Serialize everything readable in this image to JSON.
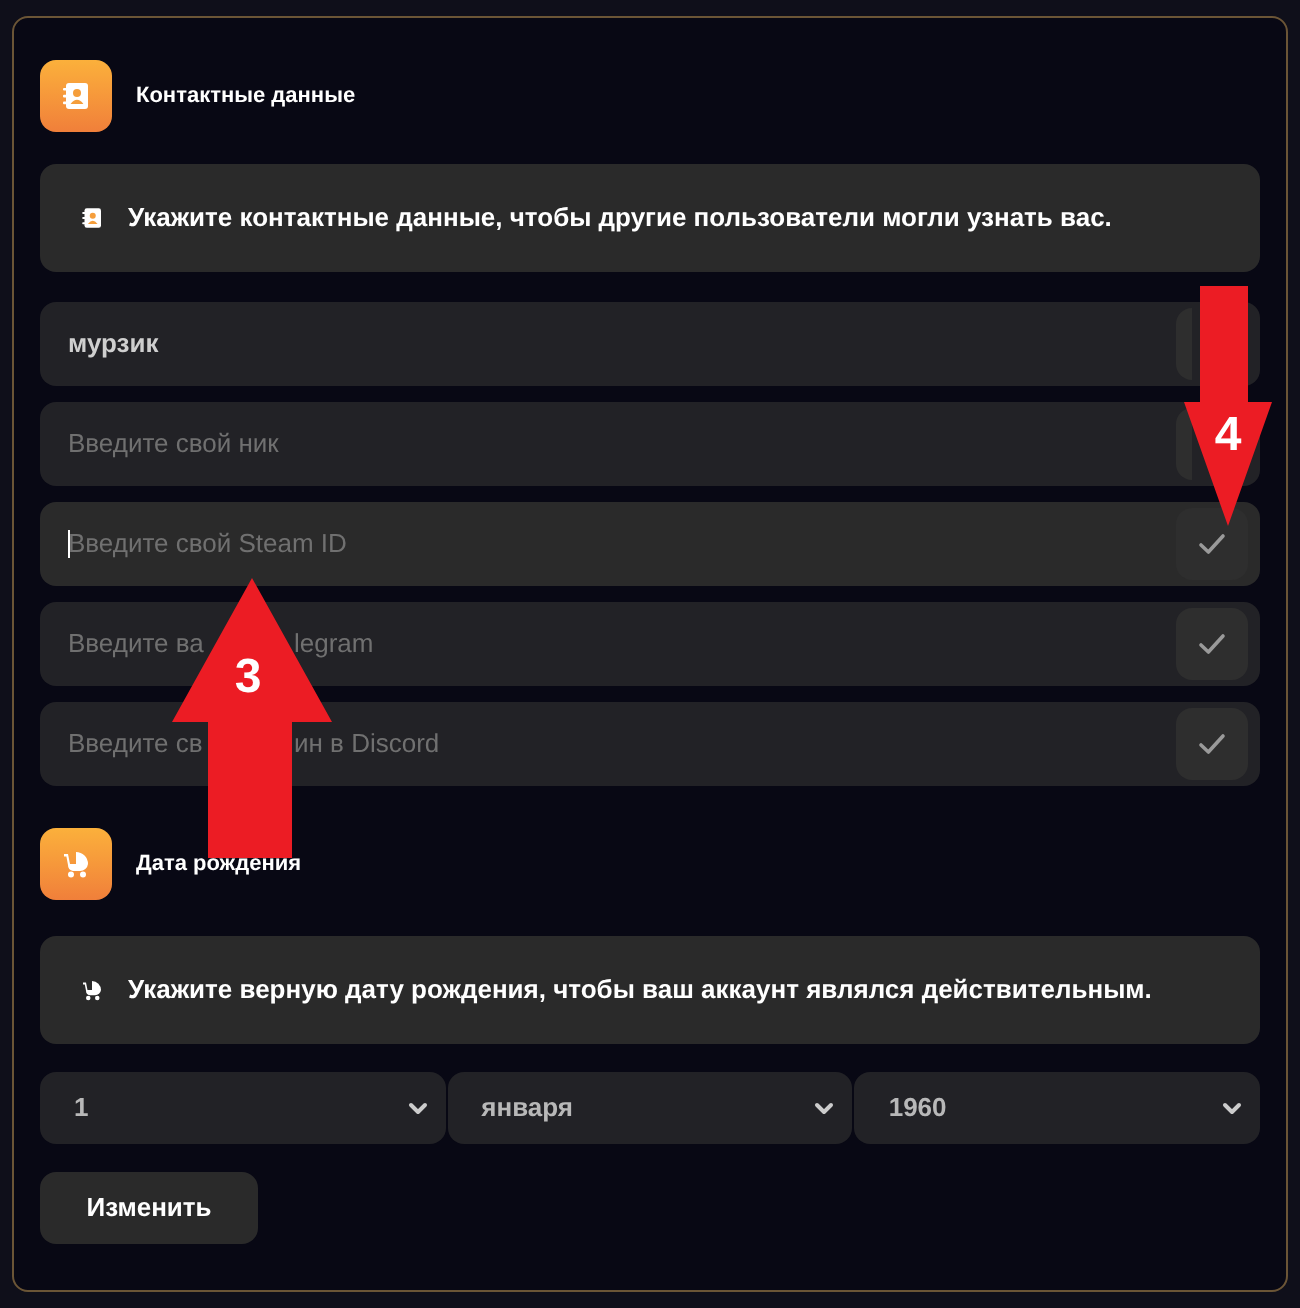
{
  "contacts": {
    "title": "Контактные данные",
    "info": "Укажите контактные данные, чтобы другие пользователи могли узнать вас.",
    "fields": [
      {
        "value": "мурзик",
        "focused": false,
        "kind": "covered"
      },
      {
        "placeholder": [
          "Введите свой ник"
        ],
        "focused": false,
        "kind": "covered"
      },
      {
        "placeholder": [
          "Введите свой Steam ID"
        ],
        "focused": true,
        "kind": "plain"
      },
      {
        "placeholder": [
          "Введите ва",
          "legram"
        ],
        "focused": false,
        "kind": "plain"
      },
      {
        "placeholder": [
          "Введите св",
          "ин в Discord"
        ],
        "focused": false,
        "kind": "plain"
      }
    ]
  },
  "birthday": {
    "title": "Дата рождения",
    "info": "Укажите верную дату рождения, чтобы ваш аккаунт являлся действительным.",
    "selects": [
      {
        "value": "1"
      },
      {
        "value": "января"
      },
      {
        "value": "1960"
      }
    ],
    "button": "Изменить"
  },
  "annotations": [
    {
      "label": "4",
      "kind": "down"
    },
    {
      "label": "3",
      "kind": "up"
    }
  ]
}
